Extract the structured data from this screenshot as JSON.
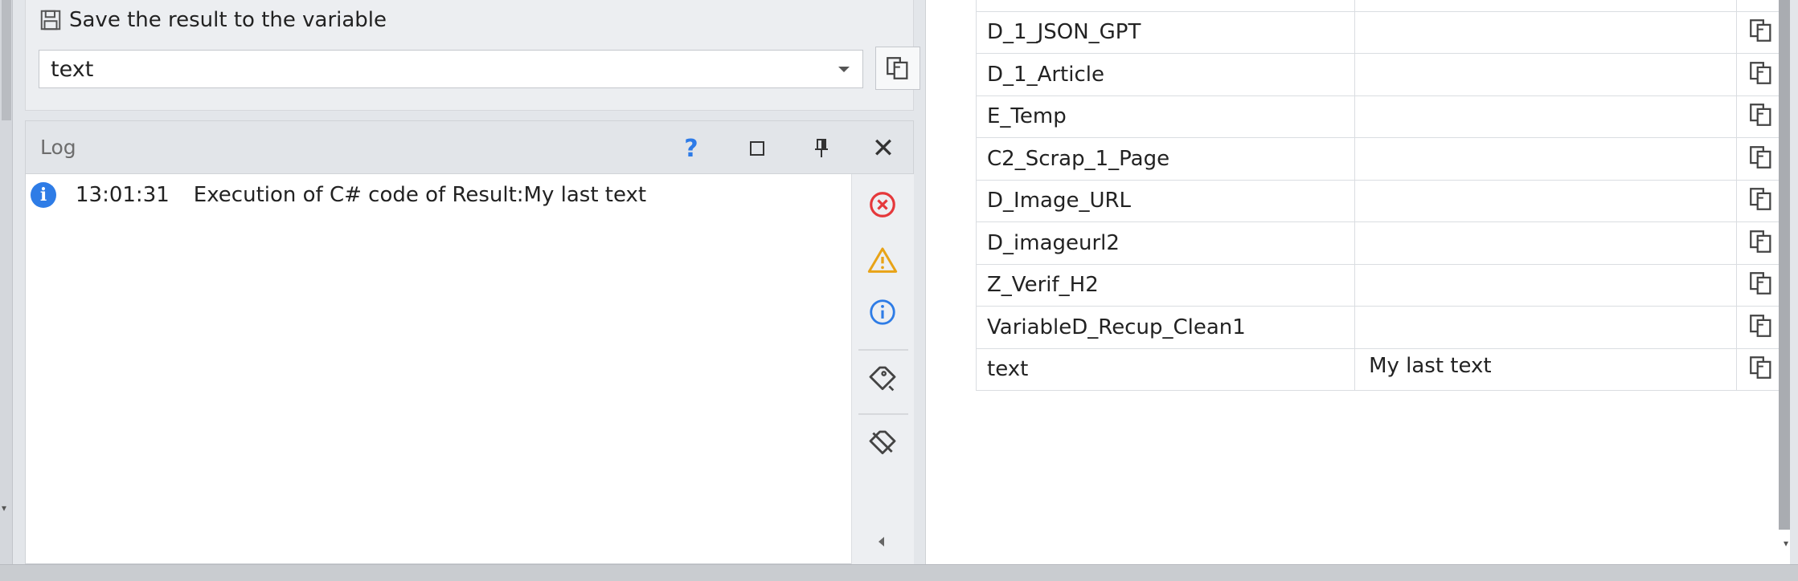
{
  "save_result": {
    "label": "Save the result to the variable",
    "selected_variable": "text",
    "icon": "save-icon",
    "copy_icon": "copy-variable-icon"
  },
  "log": {
    "title": "Log",
    "help": "?",
    "close": "✕",
    "entries": [
      {
        "level": "info",
        "time": "13:01:31",
        "message": "Execution of C# code of  Result:My last text"
      }
    ],
    "filters": [
      "error-filter-icon",
      "warning-filter-icon",
      "info-filter-icon",
      "tag-filter-icon",
      "clear-tag-icon"
    ],
    "colors": {
      "error": "#e5383b",
      "warning": "#e8a317",
      "info": "#2e7ce6"
    }
  },
  "variables": {
    "rows": [
      {
        "name": "",
        "value": ""
      },
      {
        "name": "D_1_JSON_GPT",
        "value": ""
      },
      {
        "name": "D_1_Article",
        "value": ""
      },
      {
        "name": "E_Temp",
        "value": ""
      },
      {
        "name": "C2_Scrap_1_Page",
        "value": ""
      },
      {
        "name": "D_Image_URL",
        "value": ""
      },
      {
        "name": "D_imageurl2",
        "value": ""
      },
      {
        "name": "Z_Verif_H2",
        "value": ""
      },
      {
        "name": "VariableD_Recup_Clean1",
        "value": ""
      },
      {
        "name": "text",
        "value": "My last text"
      }
    ]
  }
}
